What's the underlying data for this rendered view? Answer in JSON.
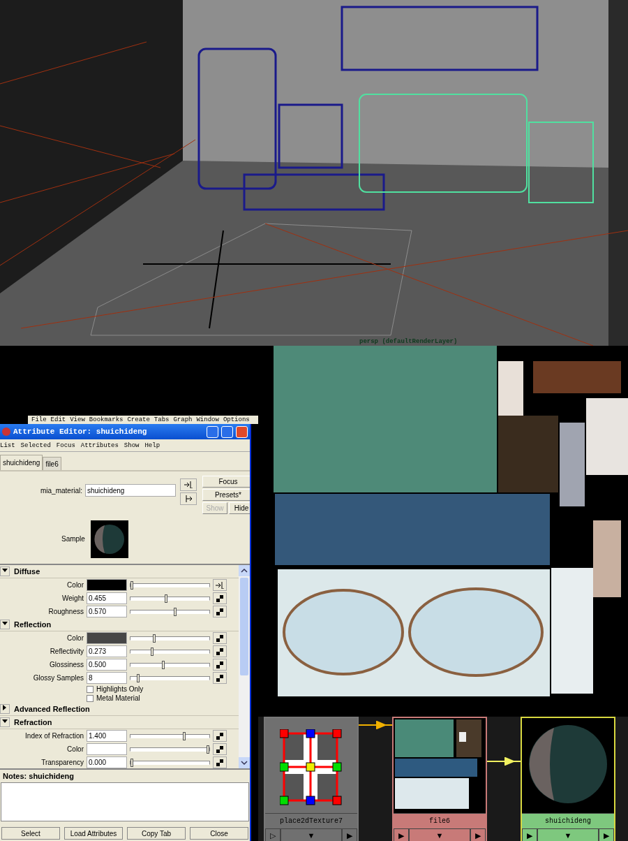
{
  "viewport": {
    "label": "persp (defaultRenderLayer)"
  },
  "hypershade_menu": [
    "File",
    "Edit",
    "View",
    "Bookmarks",
    "Create",
    "Tabs",
    "Graph",
    "Window",
    "Options"
  ],
  "attribute_editor": {
    "title": "Attribute Editor: shuichideng",
    "menu": [
      "List",
      "Selected",
      "Focus",
      "Attributes",
      "Show",
      "Help"
    ],
    "tabs": [
      {
        "label": "shuichideng",
        "selected": true
      },
      {
        "label": "file6",
        "selected": false
      }
    ],
    "node_field": {
      "label": "mia_material:",
      "value": "shuichideng"
    },
    "buttons": [
      {
        "label": "Focus",
        "disabled": false
      },
      {
        "label": "Presets*",
        "disabled": false
      }
    ],
    "toggle_buttons": [
      {
        "label": "Show",
        "disabled": true
      },
      {
        "label": "Hide",
        "disabled": false
      }
    ],
    "sample_label": "Sample",
    "sections": [
      {
        "title": "Diffuse",
        "expanded": true,
        "rows": [
          {
            "kind": "color",
            "label": "Color",
            "color": "#000000",
            "level": 0.02,
            "linked": true
          },
          {
            "kind": "number",
            "label": "Weight",
            "value": "0.455",
            "level": 0.455,
            "linked": false
          },
          {
            "kind": "number",
            "label": "Roughness",
            "value": "0.570",
            "level": 0.57,
            "linked": false
          }
        ]
      },
      {
        "title": "Reflection",
        "expanded": true,
        "rows": [
          {
            "kind": "color",
            "label": "Color",
            "color": "#464646",
            "level": 0.3,
            "linked": false
          },
          {
            "kind": "number",
            "label": "Reflectivity",
            "value": "0.273",
            "level": 0.273,
            "linked": false
          },
          {
            "kind": "number",
            "label": "Glossiness",
            "value": "0.500",
            "level": 0.42,
            "linked": false
          },
          {
            "kind": "number",
            "label": "Glossy Samples",
            "value": "8",
            "level": 0.1,
            "linked": false
          },
          {
            "kind": "checkbox",
            "label": "Highlights Only",
            "checked": false
          },
          {
            "kind": "checkbox",
            "label": "Metal Material",
            "checked": false
          }
        ]
      },
      {
        "title": "Advanced Reflection",
        "expanded": false
      },
      {
        "title": "Refraction",
        "expanded": true,
        "rows": [
          {
            "kind": "number",
            "label": "Index of Refraction",
            "value": "1.400",
            "level": 0.68,
            "linked": false
          },
          {
            "kind": "color",
            "label": "Color",
            "color": "#ffffff",
            "level": 0.98,
            "linked": false
          },
          {
            "kind": "number",
            "label": "Transparency",
            "value": "0.000",
            "level": 0.02,
            "linked": false
          }
        ]
      }
    ],
    "notes_title": "Notes:  shuichideng",
    "bottom_buttons": [
      "Select",
      "Load Attributes",
      "Copy Tab",
      "Close"
    ]
  },
  "graph": {
    "nodes": [
      {
        "kind": "place2d",
        "label": "place2dTexture7",
        "selected": false,
        "controls": [
          "▷",
          "▼",
          "▶"
        ]
      },
      {
        "kind": "file",
        "label": "file6",
        "selected": false,
        "controls": [
          "▶",
          "▼",
          "▶"
        ]
      },
      {
        "kind": "shader",
        "label": "shuichideng",
        "selected": true,
        "controls": [
          "▶",
          "▼",
          "▶"
        ]
      }
    ]
  }
}
